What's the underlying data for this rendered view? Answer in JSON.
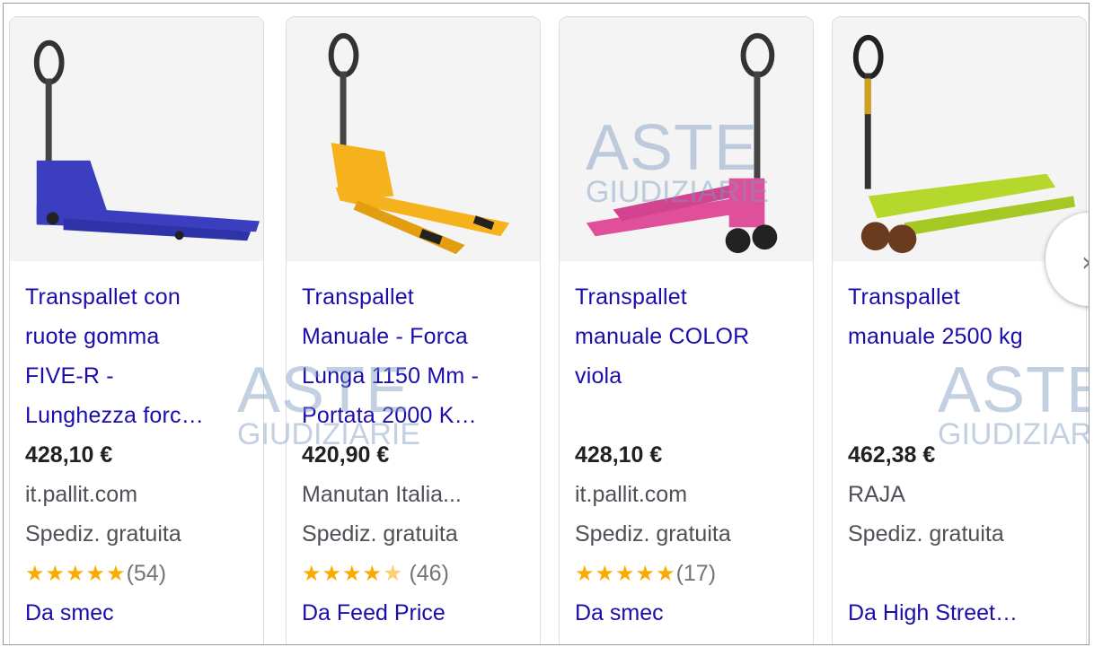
{
  "products": [
    {
      "title_lines": [
        "Transpallet con",
        "ruote gomma",
        "FIVE-R -",
        "Lunghezza forc…"
      ],
      "price": "428,10 €",
      "seller": "it.pallit.com",
      "shipping": "Spediz. gratuita",
      "stars": "★★★★★",
      "rating_value": 5.0,
      "reviews": "(54)",
      "from": "Da smec",
      "color": "#3b3fbf"
    },
    {
      "title_lines": [
        "Transpallet",
        "Manuale - Forca",
        "Lunga 1150 Mm -",
        "Portata 2000 K…"
      ],
      "price": "420,90 €",
      "seller": "Manutan Italia...",
      "shipping": "Spediz. gratuita",
      "stars": "★★★★",
      "stars_half": "★",
      "rating_value": 4.5,
      "reviews": "(46)",
      "from": "Da Feed Price",
      "color": "#f5b21c"
    },
    {
      "title_lines": [
        "Transpallet",
        "manuale COLOR",
        "viola",
        ""
      ],
      "price": "428,10 €",
      "seller": "it.pallit.com",
      "shipping": "Spediz. gratuita",
      "stars": "★★★★★",
      "rating_value": 5.0,
      "reviews": "(17)",
      "from": "Da smec",
      "color": "#e0509a"
    },
    {
      "title_lines": [
        "Transpallet",
        "manuale 2500 kg",
        "",
        ""
      ],
      "price": "462,38 €",
      "seller": "RAJA",
      "shipping": "Spediz. gratuita",
      "stars": "",
      "reviews": "",
      "from": "Da High Street…",
      "color": "#b6d82c"
    }
  ],
  "next_icon": "chevron-right-icon",
  "watermark": {
    "big": "ASTE",
    "small": "GIUDIZIARIE"
  },
  "colors": {
    "link": "#1a0dab",
    "star": "#f9ab00",
    "text": "#202124",
    "muted": "#4d5156"
  }
}
